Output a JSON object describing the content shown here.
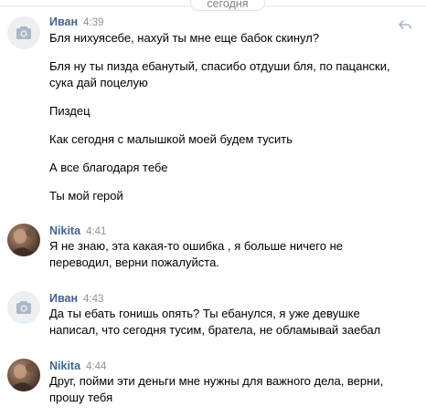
{
  "date_separator": "сегодня",
  "messages": [
    {
      "author": "Иван",
      "time": "4:39",
      "avatar": "camera-placeholder",
      "lines": [
        "Бля нихуясебе, нахуй ты мне еще бабок скинул?",
        "Бля ну ты пизда ебанутый, спасибо отдуши бля, по пацански,",
        "сука дай поцелую",
        "Пиздец",
        "Как сегодня с малышкой моей будем тусить",
        "А все благодаря тебе",
        "Ты мой герой"
      ]
    },
    {
      "author": "Nikita",
      "time": "4:41",
      "avatar": "user-photo",
      "lines": [
        "Я не знаю, эта какая-то ошибка , я больше ничего не",
        "переводил, верни пожалуйста."
      ]
    },
    {
      "author": "Иван",
      "time": "4:43",
      "avatar": "camera-placeholder",
      "lines": [
        "Да ты ебать гонишь опять? Ты ебанулся, я уже девушке",
        "написал, что сегодня тусим, братела, не обламывай заебал"
      ]
    },
    {
      "author": "Nikita",
      "time": "4:44",
      "avatar": "user-photo",
      "lines": [
        "Друг, пойми эти деньги мне нужны для важного дела, верни,",
        "прошу тебя"
      ]
    }
  ],
  "colors": {
    "author": "#42648b",
    "time": "#939393",
    "text": "#000000",
    "separator_text": "#828282"
  }
}
